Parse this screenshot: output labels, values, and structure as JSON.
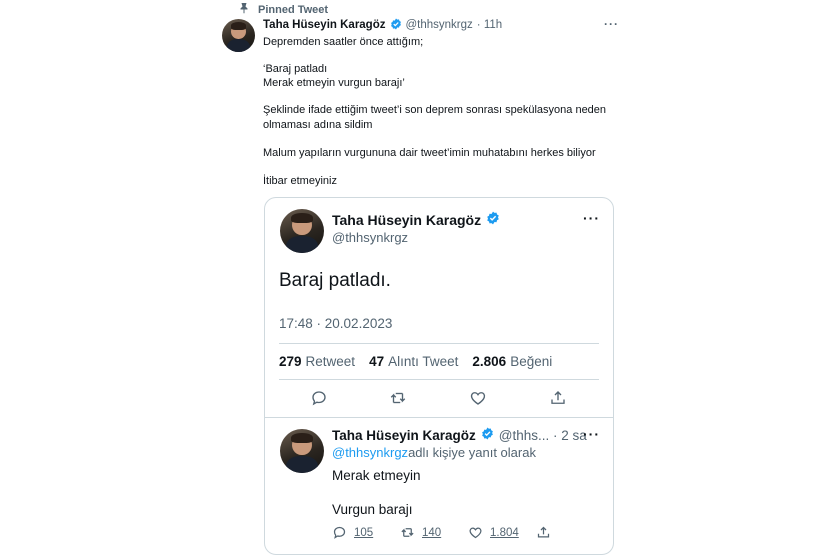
{
  "pinned": {
    "label": "Pinned Tweet"
  },
  "main_tweet": {
    "author_name": "Taha Hüseyin Karagöz",
    "handle": "@thhsynkrgz",
    "time": "· 11h",
    "lines": [
      "Depremden saatler önce attığım;",
      "‘Baraj patladı",
      "Merak etmeyin vurgun barajı’",
      "Şeklinde ifade ettiğim tweet’i son deprem sonrası spekülasyona neden",
      "olmaması adına sildim",
      "Malum yapıların vurgununa dair tweet’imin muhatabını herkes biliyor",
      "İtibar etmeyiniz"
    ]
  },
  "quoted": {
    "author_name": "Taha Hüseyin Karagöz",
    "handle": "@thhsynkrgz",
    "text": "Baraj patladı.",
    "timestamp": "17:48 · 20.02.2023",
    "stats": {
      "retweet_count": "279",
      "retweet_label": "Retweet",
      "quote_count": "47",
      "quote_label": "Alıntı Tweet",
      "like_count": "2.806",
      "like_label": "Beğeni"
    }
  },
  "reply": {
    "author_name": "Taha Hüseyin Karagöz",
    "handle_time": "@thhs... · 2 sa",
    "reply_to_handle": "@thhsynkrgz",
    "reply_to_suffix": " adlı kişiye yanıt olarak",
    "line1": "Merak etmeyin",
    "line2": "Vurgun barajı",
    "counts": {
      "replies": "105",
      "retweets": "140",
      "likes": "1.804"
    }
  },
  "colors": {
    "accent": "#1d9bf0",
    "muted": "#536471",
    "border": "#cfd9de"
  },
  "icons": [
    "pin-icon",
    "verified-badge-icon",
    "more-icon",
    "reply-icon",
    "retweet-icon",
    "like-icon",
    "share-icon"
  ]
}
